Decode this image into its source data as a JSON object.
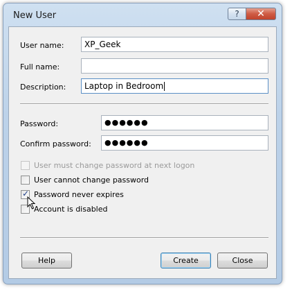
{
  "window": {
    "title": "New User",
    "help_glyph": "?",
    "close_glyph": "✕"
  },
  "fields": {
    "user_name": {
      "label": "User name:",
      "value": "XP_Geek"
    },
    "full_name": {
      "label": "Full name:",
      "value": ""
    },
    "description": {
      "label": "Description:",
      "value": "Laptop in Bedroom"
    },
    "password": {
      "label": "Password:",
      "value": "●●●●●●"
    },
    "confirm_password": {
      "label": "Confirm password:",
      "value": "●●●●●●"
    }
  },
  "options": {
    "must_change": {
      "label": "User must change password at next logon",
      "checked": false,
      "enabled": false
    },
    "cannot_change": {
      "label": "User cannot change password",
      "checked": false,
      "enabled": true
    },
    "never_expires": {
      "label": "Password never expires",
      "checked": true,
      "enabled": true
    },
    "disabled": {
      "label": "Account is disabled",
      "checked": false,
      "enabled": true
    }
  },
  "buttons": {
    "help": "Help",
    "create": "Create",
    "close": "Close"
  },
  "icons": {
    "check": "checkmark-icon",
    "cursor": "mouse-pointer-icon"
  },
  "colors": {
    "title_bar": "#bcd2e9",
    "close_button": "#c0432c",
    "checkmark": "#1f3f8a"
  }
}
